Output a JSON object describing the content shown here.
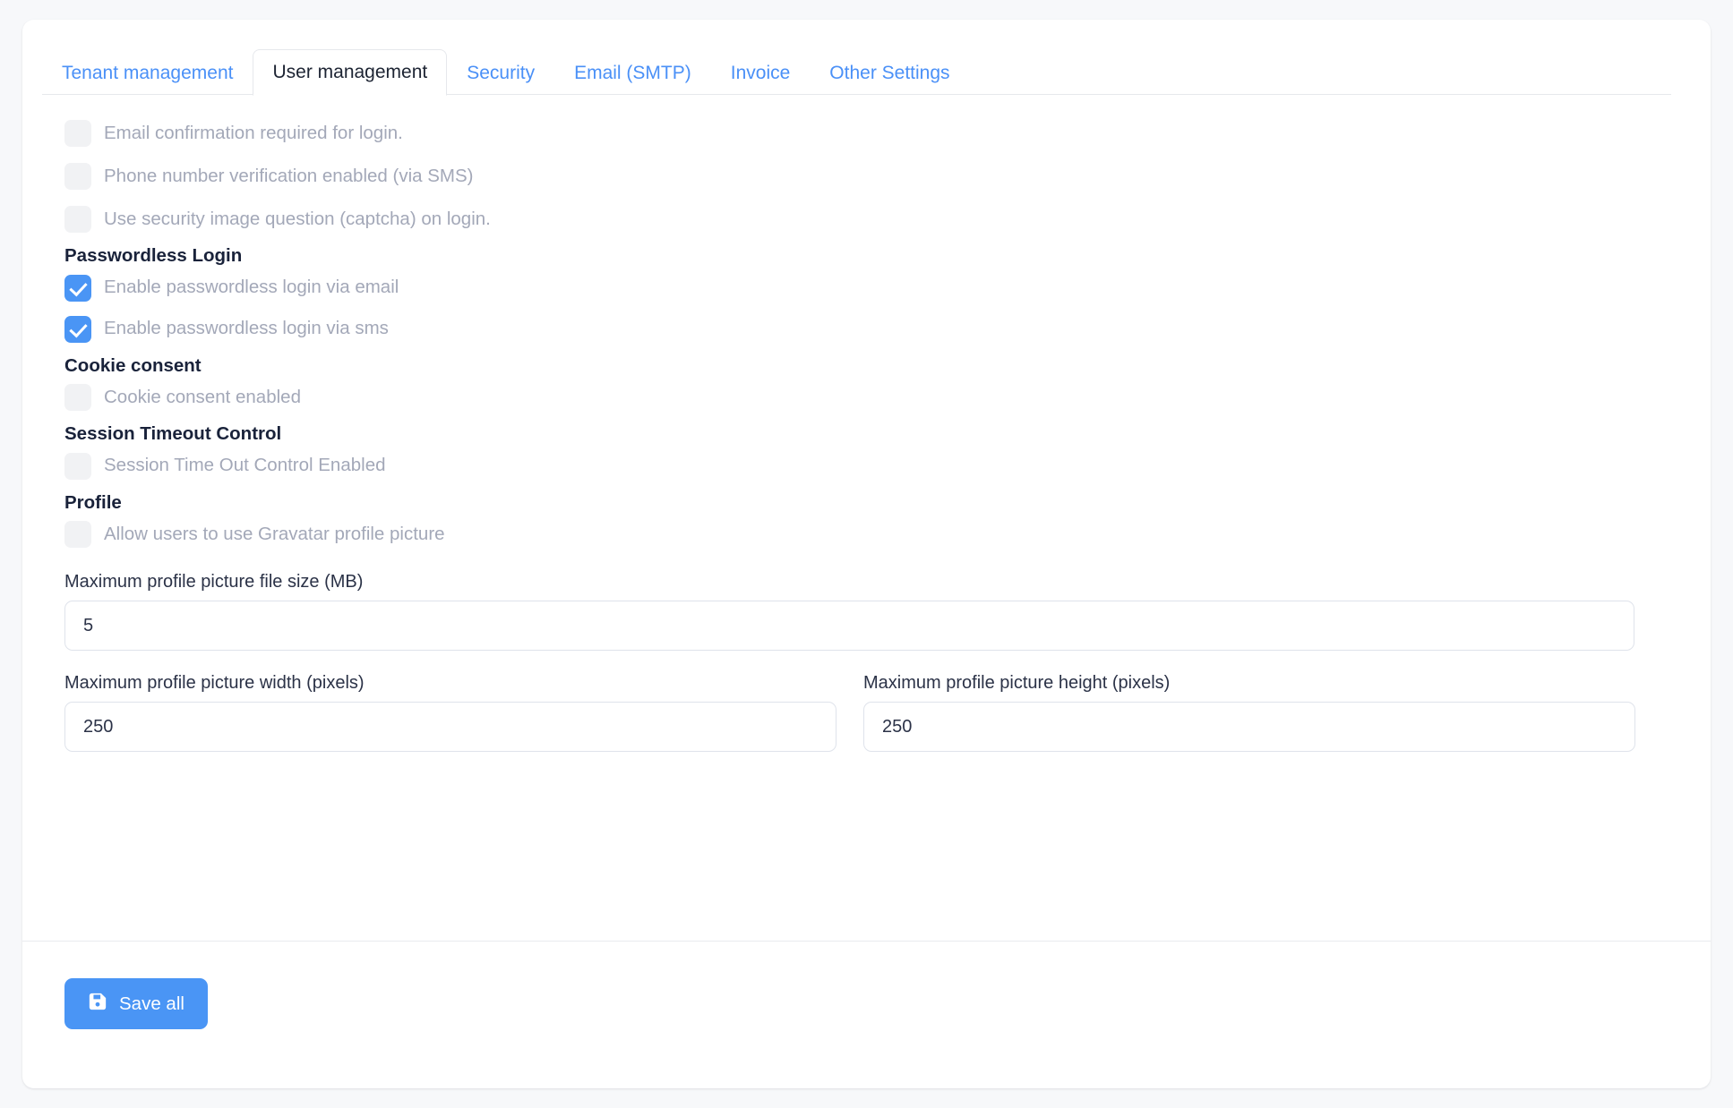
{
  "theme": {
    "accent": "#4a95f5",
    "page_bg": "#f7f8fa",
    "card_bg": "#ffffff",
    "muted_text": "#a3a8b8",
    "heading_text": "#19223a",
    "tab_link": "#4a90f7",
    "border": "#e6e8ec"
  },
  "tabs": [
    {
      "label": "Tenant management",
      "active": false
    },
    {
      "label": "User management",
      "active": true
    },
    {
      "label": "Security",
      "active": false
    },
    {
      "label": "Email (SMTP)",
      "active": false
    },
    {
      "label": "Invoice",
      "active": false
    },
    {
      "label": "Other Settings",
      "active": false
    }
  ],
  "general_checks": [
    {
      "label": "Email confirmation required for login.",
      "checked": false
    },
    {
      "label": "Phone number verification enabled (via SMS)",
      "checked": false
    },
    {
      "label": "Use security image question (captcha) on login.",
      "checked": false
    }
  ],
  "sections": {
    "passwordless": {
      "heading": "Passwordless Login",
      "checks": [
        {
          "label": "Enable passwordless login via email",
          "checked": true
        },
        {
          "label": "Enable passwordless login via sms",
          "checked": true
        }
      ]
    },
    "cookie": {
      "heading": "Cookie consent",
      "checks": [
        {
          "label": "Cookie consent enabled",
          "checked": false
        }
      ]
    },
    "session": {
      "heading": "Session Timeout Control",
      "checks": [
        {
          "label": "Session Time Out Control Enabled",
          "checked": false
        }
      ]
    },
    "profile": {
      "heading": "Profile",
      "checks": [
        {
          "label": "Allow users to use Gravatar profile picture",
          "checked": false
        }
      ]
    }
  },
  "fields": {
    "max_file_size": {
      "label": "Maximum profile picture file size (MB)",
      "value": "5"
    },
    "max_width": {
      "label": "Maximum profile picture width (pixels)",
      "value": "250"
    },
    "max_height": {
      "label": "Maximum profile picture height (pixels)",
      "value": "250"
    }
  },
  "footer": {
    "save_label": "Save all",
    "save_icon": "save-floppy-icon"
  }
}
